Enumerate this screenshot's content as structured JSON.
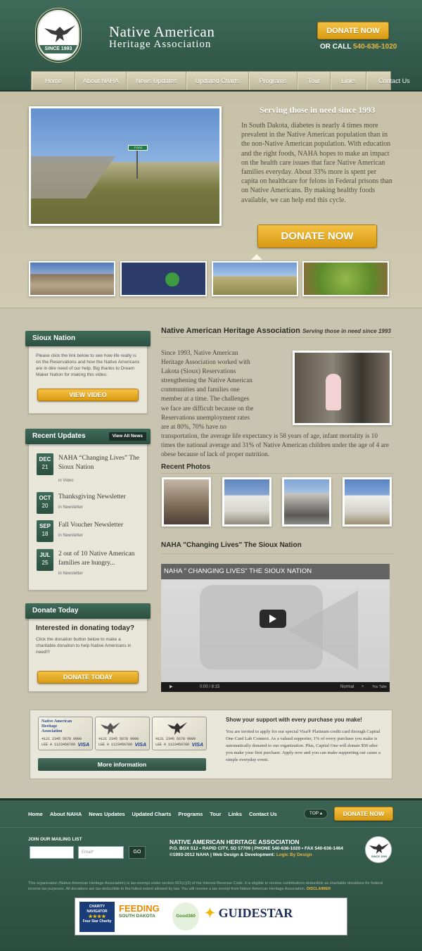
{
  "header": {
    "logo_since": "SINCE 1993",
    "brand_line1": "Native American",
    "brand_line2": "Heritage Association",
    "donate_label": "DONATE NOW",
    "call_prefix": "OR CALL",
    "phone": "540-636-1020"
  },
  "nav": [
    "Home",
    "About NAHA",
    "News Updates",
    "Updated Charts",
    "Programs",
    "Tour",
    "Links",
    "Contact Us"
  ],
  "hero": {
    "heading": "Serving those in need since 1993",
    "text": "In South Dakota, diabetes is nearly 4 times more prevalent in the Native American population than in the non-Native American population. With education and the right foods, NAHA hopes to make an impact on the health care issues that face Native American families everyday. About 33% more is spent per capita on healthcare for felons in Federal prisons than on Native Americans. By making healthy foods available, we can help end this cycle.",
    "donate_label": "DONATE NOW",
    "sign_text": "FOOD"
  },
  "sidebar": {
    "sioux": {
      "title": "Sioux Nation",
      "text": "Please click the link below to see how life really is on the Reservations and how the Native Americans are in dire need of our help. Big thanks to Dream Maker Nation for making this video.",
      "button": "VIEW VIDEO"
    },
    "updates": {
      "title": "Recent Updates",
      "view_all": "View All News",
      "items": [
        {
          "month": "DEC",
          "day": "21",
          "title": "NAHA “Changing Lives” The Sioux Nation",
          "in": "in",
          "cat": "Video"
        },
        {
          "month": "OCT",
          "day": "20",
          "title": "Thanksgiving Newsletter",
          "in": "in",
          "cat": "Newsletter"
        },
        {
          "month": "SEP",
          "day": "18",
          "title": "Fall Voucher Newsletter",
          "in": "in",
          "cat": "Newsletter"
        },
        {
          "month": "JUL",
          "day": "25",
          "title": "2 out of 10 Native American families are hungry...",
          "in": "in",
          "cat": "Newsletter"
        }
      ]
    },
    "donate": {
      "title": "Donate Today",
      "question": "Interested in donating today?",
      "text": "Click the donation button below to make a charitable donation to help Native Americans in need!!!",
      "button": "DONATE TODAY"
    }
  },
  "main": {
    "title": "Native American Heritage Association",
    "title_tag": "Serving those in need since 1993",
    "body": "Since 1993, Native American Heritage Association worked with Lakota (Sioux) Reservations strengthening the Native American communities and families one member at a time. The challenges we face are difficult because on the Reservations unemployment rates are at 80%, 70% have no transportation, the average life expectancy is 58 years of age, infant mortality is 10 times the national average and 31% of Native American children under the age of 4 are obese because of lack of proper nutrition.",
    "photos_title": "Recent Photos",
    "video_section_title": "NAHA \"Changing Lives\" The Sioux Nation",
    "video_title": "NAHA \" CHANGING LIVES\" THE SIOUX NATION",
    "video_time": "0:00 / 8:15",
    "video_quality": "Normal",
    "video_brand": "You Tube"
  },
  "support": {
    "title": "Show your support with every purchase you make!",
    "text": "You are invited to apply for our special Visa® Platinum credit card through Capital One Card Lab Connect. As a valued supporter, 1% of every purchase you make is automatically donated to our organization. Plus, Capital One will donate $50 after you make your first purchase. Apply now and you can make supporting our cause a simple everyday event.",
    "more_info": "More information",
    "card_name": "Native American Heritage Association",
    "card_number": "4121 2345 5678 9999",
    "card_holder": "LEE A 1123456789",
    "visa": "VISA"
  },
  "footer": {
    "nav": [
      "Home",
      "About NAHA",
      "News Updates",
      "Updated Charts",
      "Programs",
      "Tour",
      "Links",
      "Contact Us"
    ],
    "top": "TOP",
    "donate_label": "DONATE NOW",
    "mailing_label": "JOIN OUR MAILING LIST",
    "email_placeholder": "Email*",
    "go": "GO",
    "org_name": "NATIVE AMERICAN HERITAGE ASSOCIATION",
    "address": "P.O. BOX 512 • RAPID CITY, SD 57709 | PHONE 540-636-1020 • FAX 540-636-1464",
    "copyright": "©1993-2012 NAHA | Web Design & Development:",
    "dev": "Logic By Design",
    "logo_since": "SINCE 1993",
    "legal": "This organization (Native American Heritage Association) is tax-exempt under section 501(c)(3) of the Internal Revenue Code. It is eligible to receive contributions deductible as charitable donations for federal income tax purposes. All donations are tax-deductible to the fullest extent allowed by law. You will receive a tax receipt from Native American Heritage Association.",
    "disclaimer": "DISCLAIMER"
  },
  "partners": {
    "charity_navigator": "CHARITY NAVIGATOR",
    "charity_stars": "★★★★",
    "charity_rating": "Four Star Charity",
    "feeding": "FEEDING",
    "feeding_sub": "SOUTH DAKOTA",
    "good360": "Good360",
    "guidestar": "GUIDESTAR"
  },
  "colors": {
    "green": "#2c5142",
    "gold": "#e4b445",
    "background": "#c9c4b0"
  }
}
